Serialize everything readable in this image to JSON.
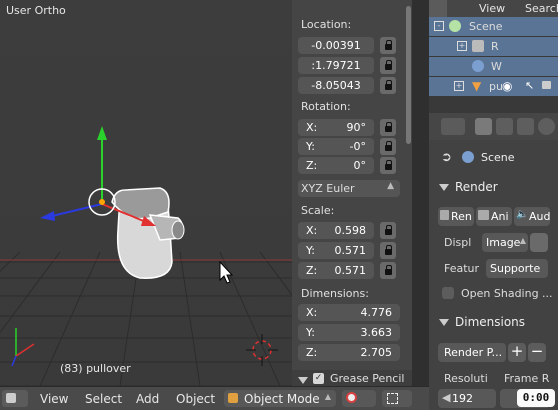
{
  "viewport": {
    "title": "User Ortho",
    "object_label": "(83) pullover"
  },
  "npanel": {
    "location": {
      "label": "Location:",
      "x": "-0.00391",
      "y": ":1.79721",
      "z": "-8.05043"
    },
    "rotation": {
      "label": "Rotation:",
      "x_key": "X:",
      "x": "90°",
      "y_key": "Y:",
      "y": "-0°",
      "z_key": "Z:",
      "z": "0°",
      "mode": "XYZ Euler"
    },
    "scale": {
      "label": "Scale:",
      "x_key": "X:",
      "x": "0.598",
      "y_key": "Y:",
      "y": "0.571",
      "z_key": "Z:",
      "z": "0.571"
    },
    "dimensions": {
      "label": "Dimensions:",
      "x_key": "X:",
      "x": "4.776",
      "y_key": "Y:",
      "y": "3.663",
      "z_key": "Z:",
      "z": "2.705"
    },
    "grease_pencil": "Grease Pencil"
  },
  "outliner": {
    "view": "View",
    "search": "Search",
    "rows": [
      {
        "label": "Scene"
      },
      {
        "label": "R"
      },
      {
        "label": "W"
      },
      {
        "label": "pu"
      }
    ]
  },
  "properties": {
    "context": "Scene",
    "render_section": "Render",
    "render_buttons": [
      "Ren",
      "Ani",
      "Aud"
    ],
    "display_label": "Displ",
    "display_value": "Image",
    "feature_label": "Featur",
    "feature_value": "Supporte",
    "open_shading": "Open Shading ...",
    "dimensions_section": "Dimensions",
    "render_presets": "Render P...",
    "resolution_label": "Resoluti",
    "frame_label": "Frame R",
    "resolution_value": "192"
  },
  "header": {
    "menus": [
      "View",
      "Select",
      "Add",
      "Object"
    ],
    "mode": "Object Mode"
  },
  "watermark": "0:00",
  "colors": {
    "outliner_selected": "#5a7495",
    "accent_red": "#d94040",
    "axis_x": "#d22",
    "axis_y": "#2c2",
    "axis_z": "#22d"
  }
}
